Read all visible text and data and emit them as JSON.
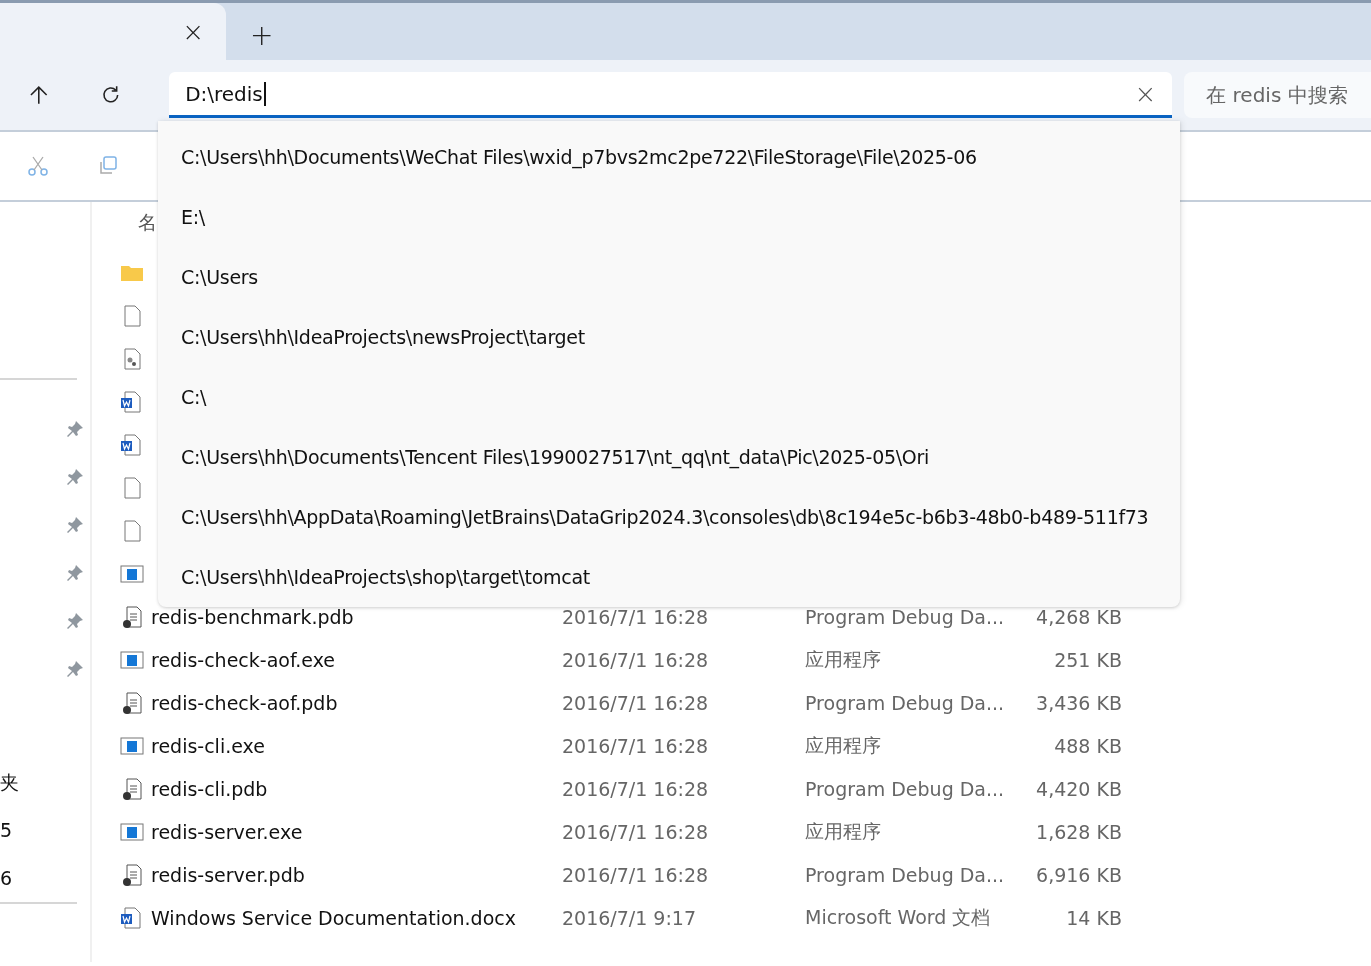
{
  "address": {
    "value": "D:\\redis",
    "clear": "×"
  },
  "search": {
    "placeholder": "在 redis 中搜索"
  },
  "tab": {
    "close": "×",
    "new": "+"
  },
  "suggestions": [
    "C:\\Users\\hh\\Documents\\WeChat Files\\wxid_p7bvs2mc2pe722\\FileStorage\\File\\2025-06",
    "E:\\",
    "C:\\Users",
    "C:\\Users\\hh\\IdeaProjects\\newsProject\\target",
    "C:\\",
    "C:\\Users\\hh\\Documents\\Tencent Files\\1990027517\\nt_qq\\nt_data\\Pic\\2025-05\\Ori",
    "C:\\Users\\hh\\AppData\\Roaming\\JetBrains\\DataGrip2024.3\\consoles\\db\\8c194e5c-b6b3-48b0-b489-511f73",
    "C:\\Users\\hh\\IdeaProjects\\shop\\target\\tomcat"
  ],
  "sidebar": {
    "pinned_count_rows": [
      {
        "pinned": true
      },
      {
        "pinned": true
      },
      {
        "pinned": true
      },
      {
        "pinned": true
      },
      {
        "pinned": true
      },
      {
        "pinned": true
      }
    ],
    "lower_items": [
      "夹",
      "5",
      "6"
    ]
  },
  "table": {
    "header": "名",
    "rows": [
      {
        "kind": "folder"
      },
      {
        "kind": "blank"
      },
      {
        "kind": "config"
      },
      {
        "kind": "word"
      },
      {
        "kind": "word"
      },
      {
        "kind": "blank"
      },
      {
        "kind": "blank"
      },
      {
        "kind": "exe"
      },
      {
        "kind": "pdb",
        "name": "redis-benchmark.pdb",
        "date": "2016/7/1 16:28",
        "type": "Program Debug Da...",
        "size": "4,268 KB"
      },
      {
        "kind": "exe",
        "name": "redis-check-aof.exe",
        "date": "2016/7/1 16:28",
        "type": "应用程序",
        "size": "251 KB"
      },
      {
        "kind": "pdb",
        "name": "redis-check-aof.pdb",
        "date": "2016/7/1 16:28",
        "type": "Program Debug Da...",
        "size": "3,436 KB"
      },
      {
        "kind": "exe",
        "name": "redis-cli.exe",
        "date": "2016/7/1 16:28",
        "type": "应用程序",
        "size": "488 KB"
      },
      {
        "kind": "pdb",
        "name": "redis-cli.pdb",
        "date": "2016/7/1 16:28",
        "type": "Program Debug Da...",
        "size": "4,420 KB"
      },
      {
        "kind": "exe",
        "name": "redis-server.exe",
        "date": "2016/7/1 16:28",
        "type": "应用程序",
        "size": "1,628 KB"
      },
      {
        "kind": "pdb",
        "name": "redis-server.pdb",
        "date": "2016/7/1 16:28",
        "type": "Program Debug Da...",
        "size": "6,916 KB"
      },
      {
        "kind": "word",
        "name": "Windows Service Documentation.docx",
        "date": "2016/7/1 9:17",
        "type": "Microsoft Word 文档",
        "size": "14 KB"
      }
    ]
  }
}
